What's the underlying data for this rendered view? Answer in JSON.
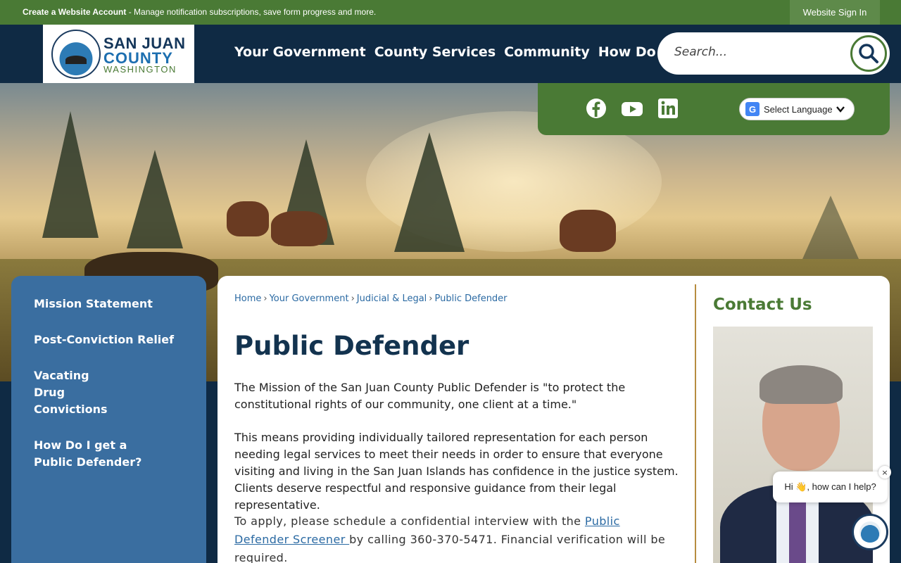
{
  "topbar": {
    "create_account": "Create a Website Account",
    "message": " - Manage notification subscriptions, save form progress and more.",
    "sign_in": "Website Sign In"
  },
  "logo": {
    "line1": "SAN JUAN",
    "line2": "COUNTY",
    "line3": "WASHINGTON"
  },
  "nav": {
    "items": [
      "Your Government",
      "County Services",
      "Community",
      "How Do I..."
    ]
  },
  "search": {
    "placeholder": "Search..."
  },
  "social": {
    "icons": [
      "facebook-icon",
      "youtube-icon",
      "linkedin-icon"
    ],
    "language_label": "Select Language"
  },
  "sidebar": {
    "items": [
      {
        "label": "Mission Statement"
      },
      {
        "label": "Post-Conviction Relief"
      },
      {
        "label": "Vacating Drug Convictions"
      },
      {
        "label": "How Do I get a Public Defender?"
      }
    ]
  },
  "breadcrumb": {
    "items": [
      "Home",
      "Your Government",
      "Judicial & Legal",
      "Public Defender"
    ]
  },
  "main": {
    "title": "Public Defender",
    "p1": "The Mission of the San Juan County Public Defender is \"to protect the constitutional rights of our community, one client at a time.\"",
    "p2": "This means providing individually tailored representation for each person needing legal services to meet their needs in order to ensure that everyone visiting and living in the San Juan Islands has confidence in the justice system. Clients deserve respectful and responsive guidance from their legal representative.",
    "p3_before": "To apply, please schedule a confidential interview with the ",
    "p3_link": "Public Defender Screener ",
    "p3_after": "by calling 360-370-5471. Financial verification will be required."
  },
  "contact": {
    "title": "Contact Us"
  },
  "chat": {
    "greeting": "Hi 👋, how can I help?",
    "close": "×"
  },
  "colors": {
    "green": "#4a7a35",
    "navy": "#0f2a44",
    "sidebar_blue": "#3a6ea0",
    "link": "#2b6aa3"
  }
}
